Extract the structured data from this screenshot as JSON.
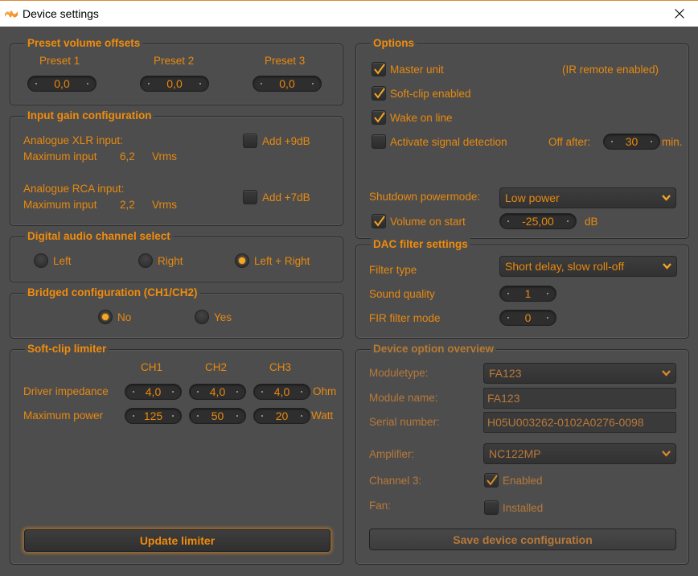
{
  "window": {
    "title": "Device settings",
    "icon": "app-logo-icon",
    "close_icon": "close-icon"
  },
  "preset_offsets": {
    "title": "Preset volume offsets",
    "presets": [
      {
        "label": "Preset 1",
        "value": "0,0"
      },
      {
        "label": "Preset 2",
        "value": "0,0"
      },
      {
        "label": "Preset 3",
        "value": "0,0"
      }
    ]
  },
  "input_gain": {
    "title": "Input gain configuration",
    "xlr": {
      "label": "Analogue XLR input:",
      "max_label": "Maximum input",
      "max_value": "6,2",
      "unit": "Vrms",
      "checkbox_label": "Add +9dB",
      "checked": false
    },
    "rca": {
      "label": "Analogue RCA input:",
      "max_label": "Maximum input",
      "max_value": "2,2",
      "unit": "Vrms",
      "checkbox_label": "Add +7dB",
      "checked": false
    }
  },
  "digital_channel": {
    "title": "Digital audio channel select",
    "options": [
      {
        "label": "Left",
        "selected": false
      },
      {
        "label": "Right",
        "selected": false
      },
      {
        "label": "Left + Right",
        "selected": true
      }
    ]
  },
  "bridged": {
    "title": "Bridged configuration (CH1/CH2)",
    "options": [
      {
        "label": "No",
        "selected": true
      },
      {
        "label": "Yes",
        "selected": false
      }
    ]
  },
  "softclip": {
    "title": "Soft-clip limiter",
    "channels": [
      "CH1",
      "CH2",
      "CH3"
    ],
    "impedance": {
      "label": "Driver impedance",
      "values": [
        "4,0",
        "4,0",
        "4,0"
      ],
      "unit": "Ohm"
    },
    "power": {
      "label": "Maximum power",
      "values": [
        "125",
        "50",
        "20"
      ],
      "unit": "Watt"
    },
    "update_button": "Update limiter"
  },
  "options": {
    "title": "Options",
    "master_unit": {
      "label": "Master unit",
      "checked": true
    },
    "ir_note": "(IR remote enabled)",
    "softclip_enabled": {
      "label": "Soft-clip enabled",
      "checked": true
    },
    "wake_on_line": {
      "label": "Wake on line",
      "checked": true
    },
    "signal_detection": {
      "label": "Activate signal detection",
      "checked": false
    },
    "off_after": {
      "label": "Off after:",
      "value": "30",
      "unit": "min."
    },
    "shutdown_mode": {
      "label": "Shutdown powermode:",
      "value": "Low power"
    },
    "volume_on_start": {
      "label": "Volume on start",
      "checked": true,
      "value": "-25,00",
      "unit": "dB"
    }
  },
  "dac_filter": {
    "title": "DAC filter settings",
    "filter_type": {
      "label": "Filter type",
      "value": "Short delay, slow roll-off"
    },
    "sound_quality": {
      "label": "Sound quality",
      "value": "1"
    },
    "fir_mode": {
      "label": "FIR filter mode",
      "value": "0"
    }
  },
  "device_overview": {
    "title": "Device option overview",
    "moduletype": {
      "label": "Moduletype:",
      "value": "FA123"
    },
    "module_name": {
      "label": "Module name:",
      "value": "FA123"
    },
    "serial": {
      "label": "Serial number:",
      "value": "H05U003262-0102A0276-0098"
    },
    "amplifier": {
      "label": "Amplifier:",
      "value": "NC122MP"
    },
    "channel3": {
      "label": "Channel 3:",
      "checkbox_label": "Enabled",
      "checked": true
    },
    "fan": {
      "label": "Fan:",
      "checkbox_label": "Installed",
      "checked": false
    },
    "save_button": "Save device configuration"
  },
  "colors": {
    "accent": "#f08c0c",
    "background": "#4d4d4d",
    "disabled_text": "#b8793a"
  }
}
